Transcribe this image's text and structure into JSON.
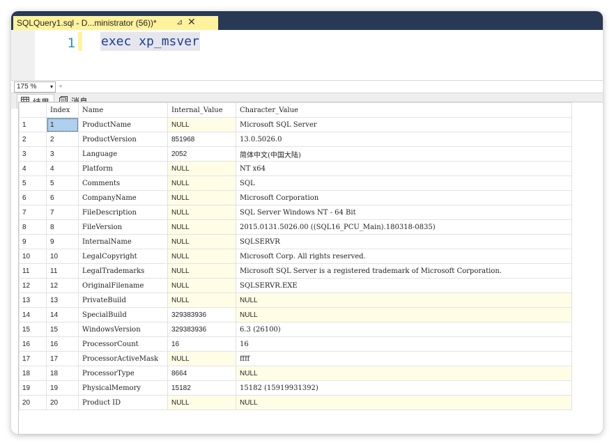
{
  "tab": {
    "title": "SQLQuery1.sql - D...ministrator (56))*",
    "pin": "⊿",
    "close": "✕"
  },
  "editor": {
    "line_number": "1",
    "code": "exec xp_msver"
  },
  "zoom": {
    "value": "175 %",
    "arrow": "▾",
    "scroll_left": "◂"
  },
  "results_tabs": [
    {
      "label": "结果",
      "icon": "grid-icon"
    },
    {
      "label": "消息",
      "icon": "messages-icon"
    }
  ],
  "grid": {
    "columns": [
      "",
      "Index",
      "Name",
      "Internal_Value",
      "Character_Value"
    ],
    "rows": [
      [
        "1",
        "1",
        "ProductName",
        "NULL",
        "Microsoft SQL Server"
      ],
      [
        "2",
        "2",
        "ProductVersion",
        "851968",
        "13.0.5026.0"
      ],
      [
        "3",
        "3",
        "Language",
        "2052",
        "简体中文(中国大陆)"
      ],
      [
        "4",
        "4",
        "Platform",
        "NULL",
        "NT x64"
      ],
      [
        "5",
        "5",
        "Comments",
        "NULL",
        "SQL"
      ],
      [
        "6",
        "6",
        "CompanyName",
        "NULL",
        "Microsoft Corporation"
      ],
      [
        "7",
        "7",
        "FileDescription",
        "NULL",
        "SQL Server Windows NT - 64 Bit"
      ],
      [
        "8",
        "8",
        "FileVersion",
        "NULL",
        "2015.0131.5026.00 ((SQL16_PCU_Main).180318-0835)"
      ],
      [
        "9",
        "9",
        "InternalName",
        "NULL",
        "SQLSERVR"
      ],
      [
        "10",
        "10",
        "LegalCopyright",
        "NULL",
        "Microsoft Corp. All rights reserved."
      ],
      [
        "11",
        "11",
        "LegalTrademarks",
        "NULL",
        "Microsoft SQL Server is a registered trademark of Microsoft Corporation."
      ],
      [
        "12",
        "12",
        "OriginalFilename",
        "NULL",
        "SQLSERVR.EXE"
      ],
      [
        "13",
        "13",
        "PrivateBuild",
        "NULL",
        "NULL"
      ],
      [
        "14",
        "14",
        "SpecialBuild",
        "329383936",
        "NULL"
      ],
      [
        "15",
        "15",
        "WindowsVersion",
        "329383936",
        "6.3 (26100)"
      ],
      [
        "16",
        "16",
        "ProcessorCount",
        "16",
        "16"
      ],
      [
        "17",
        "17",
        "ProcessorActiveMask",
        "NULL",
        "            ffff"
      ],
      [
        "18",
        "18",
        "ProcessorType",
        "8664",
        "NULL"
      ],
      [
        "19",
        "19",
        "PhysicalMemory",
        "15182",
        "15182 (15919931392)"
      ],
      [
        "20",
        "20",
        "Product ID",
        "NULL",
        "NULL"
      ]
    ]
  },
  "colors": {
    "tabbar_bg": "#293955",
    "active_tab_bg": "#fff29d",
    "null_cell_bg": "#fffde6",
    "selected_cell_bg": "#aecfee",
    "keyword_color": "#1f3c9a"
  }
}
